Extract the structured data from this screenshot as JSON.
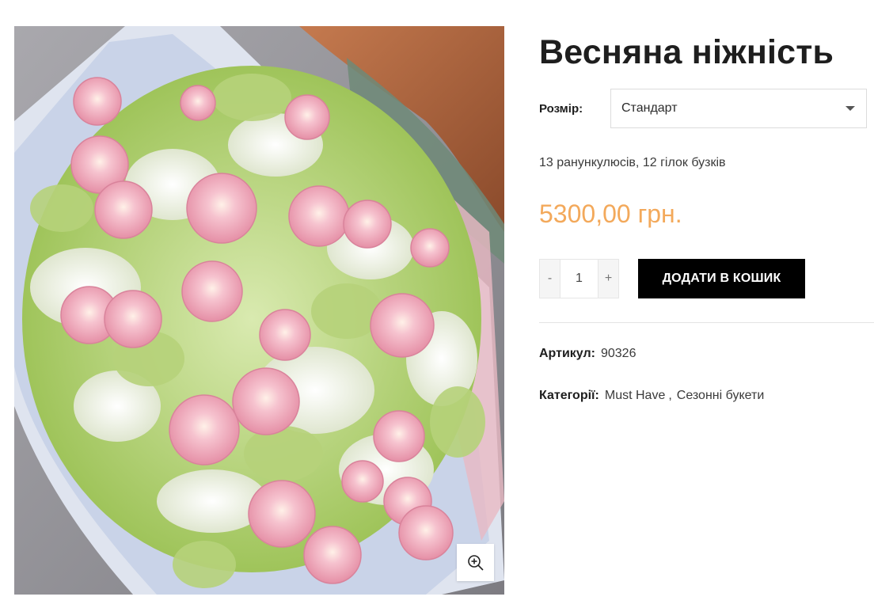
{
  "product": {
    "title": "Весняна ніжність",
    "size_label": "Розмір:",
    "size_selected": "Стандарт",
    "description": "13 ранункулюсів, 12 гілок бузків",
    "price": "5300,00 грн.",
    "quantity": "1",
    "qty_minus": "-",
    "qty_plus": "+",
    "add_to_cart": "ДОДАТИ В КОШИК",
    "sku_label": "Артикул:",
    "sku_value": "90326",
    "categories_label": "Категорії:",
    "categories": [
      "Must Have",
      "Сезонні букети"
    ],
    "category_separator": ","
  },
  "gallery": {
    "zoom_icon": "zoom-in-icon"
  },
  "colors": {
    "price": "#f3a95b",
    "button_bg": "#000000",
    "button_text": "#ffffff"
  }
}
